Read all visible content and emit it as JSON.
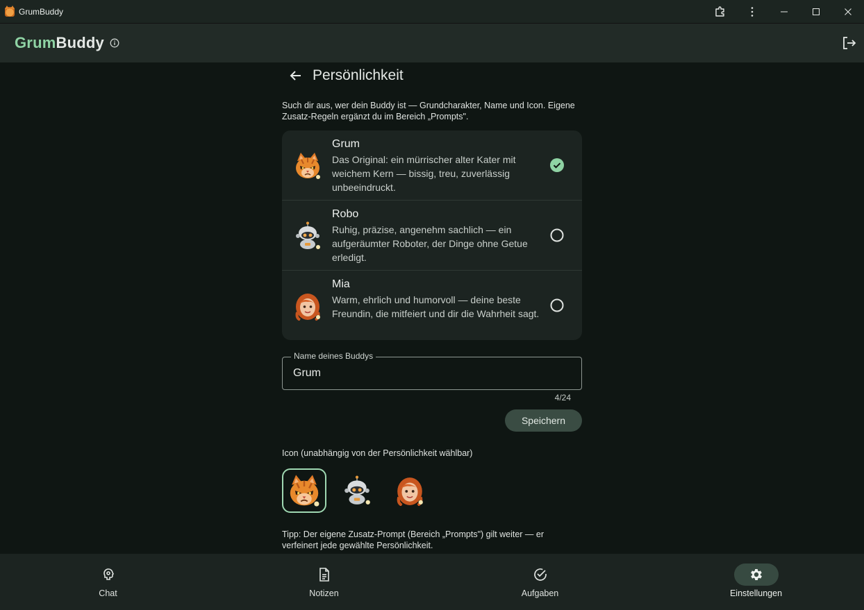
{
  "window": {
    "title": "GrumBuddy"
  },
  "appbar": {
    "brand_part1": "Grum",
    "brand_part2": "Buddy",
    "info_icon": "info-icon",
    "logout_icon": "logout-icon"
  },
  "page": {
    "title": "Persönlichkeit",
    "intro": "Such dir aus, wer dein Buddy ist — Grundcharakter, Name und Icon. Eigene Zusatz-Regeln ergänzt du im Bereich „Prompts\".",
    "personalities": [
      {
        "name": "Grum",
        "description": "Das Original: ein mürrischer alter Kater mit weichem Kern — bissig, treu, zuverlässig unbeeindruckt.",
        "selected": true,
        "avatar": "cat-avatar"
      },
      {
        "name": "Robo",
        "description": "Ruhig, präzise, angenehm sachlich — ein aufgeräumter Roboter, der Dinge ohne Getue erledigt.",
        "selected": false,
        "avatar": "robot-avatar"
      },
      {
        "name": "Mia",
        "description": "Warm, ehrlich und humorvoll — deine beste Freundin, die mitfeiert und dir die Wahrheit sagt.",
        "selected": false,
        "avatar": "girl-avatar"
      }
    ],
    "name_field": {
      "label": "Name deines Buddys",
      "value": "Grum",
      "counter": "4/24"
    },
    "save_label": "Speichern",
    "icon_section_label": "Icon (unabhängig von der Persönlichkeit wählbar)",
    "icons": [
      "cat-avatar",
      "robot-avatar",
      "girl-avatar"
    ],
    "selected_icon": "cat-avatar",
    "tip": "Tipp: Der eigene Zusatz-Prompt (Bereich „Prompts\") gilt weiter — er verfeinert jede gewählte Persönlichkeit."
  },
  "bottom_nav": [
    {
      "label": "Chat",
      "icon": "brain-icon",
      "active": false
    },
    {
      "label": "Notizen",
      "icon": "document-icon",
      "active": false
    },
    {
      "label": "Aufgaben",
      "icon": "check-circle-icon",
      "active": false
    },
    {
      "label": "Einstellungen",
      "icon": "gear-icon",
      "active": true
    }
  ],
  "colors": {
    "accent": "#8fd3a4",
    "background": "#0f1613",
    "surface": "#1c2421",
    "appbar": "#222b27"
  }
}
